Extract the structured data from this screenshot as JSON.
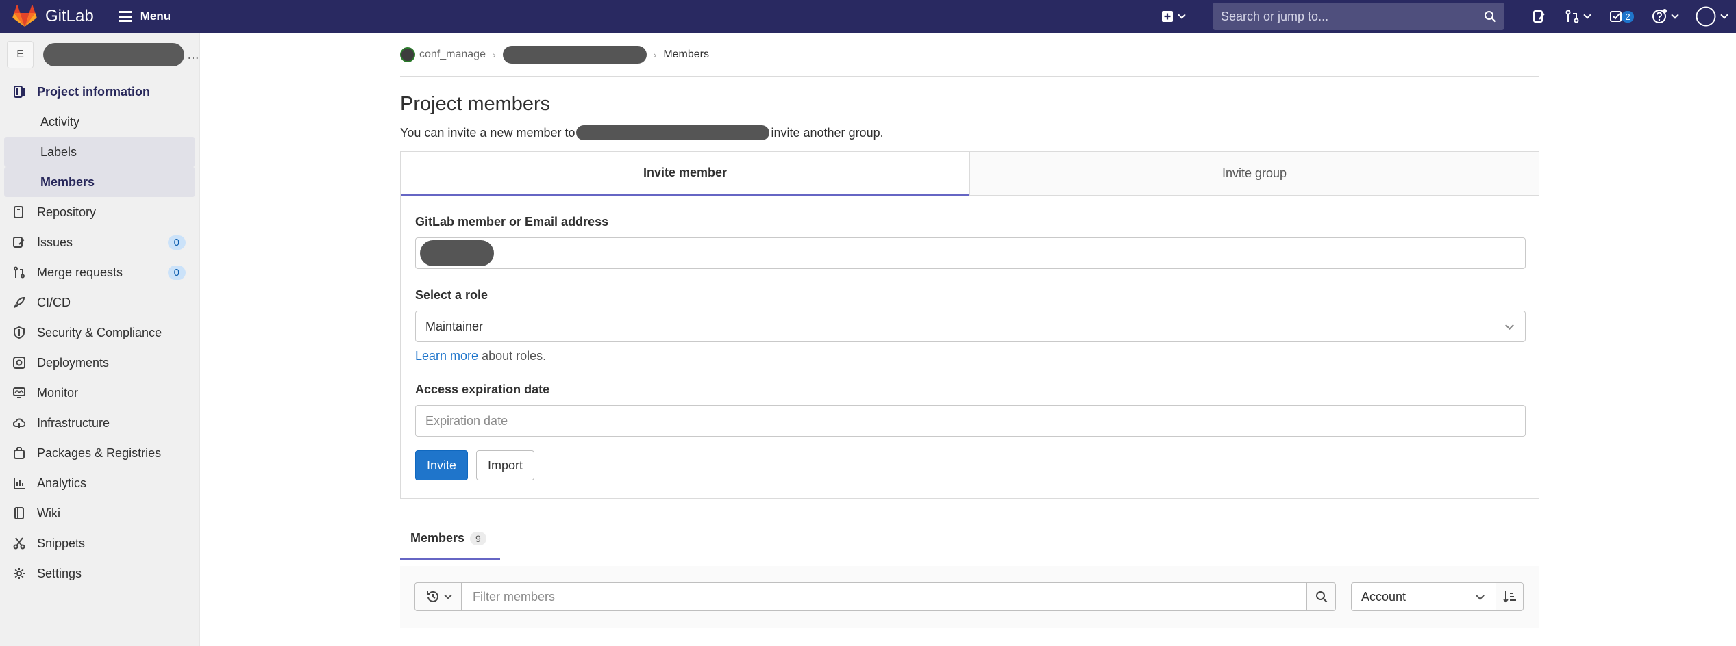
{
  "topbar": {
    "brand": "GitLab",
    "menu_label": "Menu",
    "search_placeholder": "Search or jump to...",
    "todo_count": "2"
  },
  "sidebar": {
    "avatar_letter": "E",
    "section_header": "Project information",
    "sub_items": [
      "Activity",
      "Labels",
      "Members"
    ],
    "items": [
      {
        "label": "Repository",
        "icon": "doc-icon"
      },
      {
        "label": "Issues",
        "icon": "issues-icon",
        "badge": "0"
      },
      {
        "label": "Merge requests",
        "icon": "merge-request-icon",
        "badge": "0"
      },
      {
        "label": "CI/CD",
        "icon": "rocket-icon"
      },
      {
        "label": "Security & Compliance",
        "icon": "shield-icon"
      },
      {
        "label": "Deployments",
        "icon": "deployments-icon"
      },
      {
        "label": "Monitor",
        "icon": "monitor-icon"
      },
      {
        "label": "Infrastructure",
        "icon": "cloud-icon"
      },
      {
        "label": "Packages & Registries",
        "icon": "package-icon"
      },
      {
        "label": "Analytics",
        "icon": "chart-icon"
      },
      {
        "label": "Wiki",
        "icon": "book-icon"
      },
      {
        "label": "Snippets",
        "icon": "scissors-icon"
      },
      {
        "label": "Settings",
        "icon": "gear-icon"
      }
    ]
  },
  "breadcrumb": {
    "group": "conf_manage",
    "current": "Members"
  },
  "page": {
    "title": "Project members",
    "intro_before": "You can invite a new member to",
    "intro_after": "invite another group."
  },
  "invite": {
    "tab_member": "Invite member",
    "tab_group": "Invite group",
    "member_label": "GitLab member or Email address",
    "role_label": "Select a role",
    "role_value": "Maintainer",
    "help_link": "Learn more",
    "help_text": "about roles.",
    "expiry_label": "Access expiration date",
    "expiry_placeholder": "Expiration date",
    "invite_button": "Invite",
    "import_button": "Import"
  },
  "members": {
    "tab_label": "Members",
    "count": "9",
    "filter_placeholder": "Filter members",
    "sort_value": "Account"
  },
  "colors": {
    "navbar": "#292961",
    "primary": "#1f75cb",
    "tab_accent": "#6666c4"
  }
}
